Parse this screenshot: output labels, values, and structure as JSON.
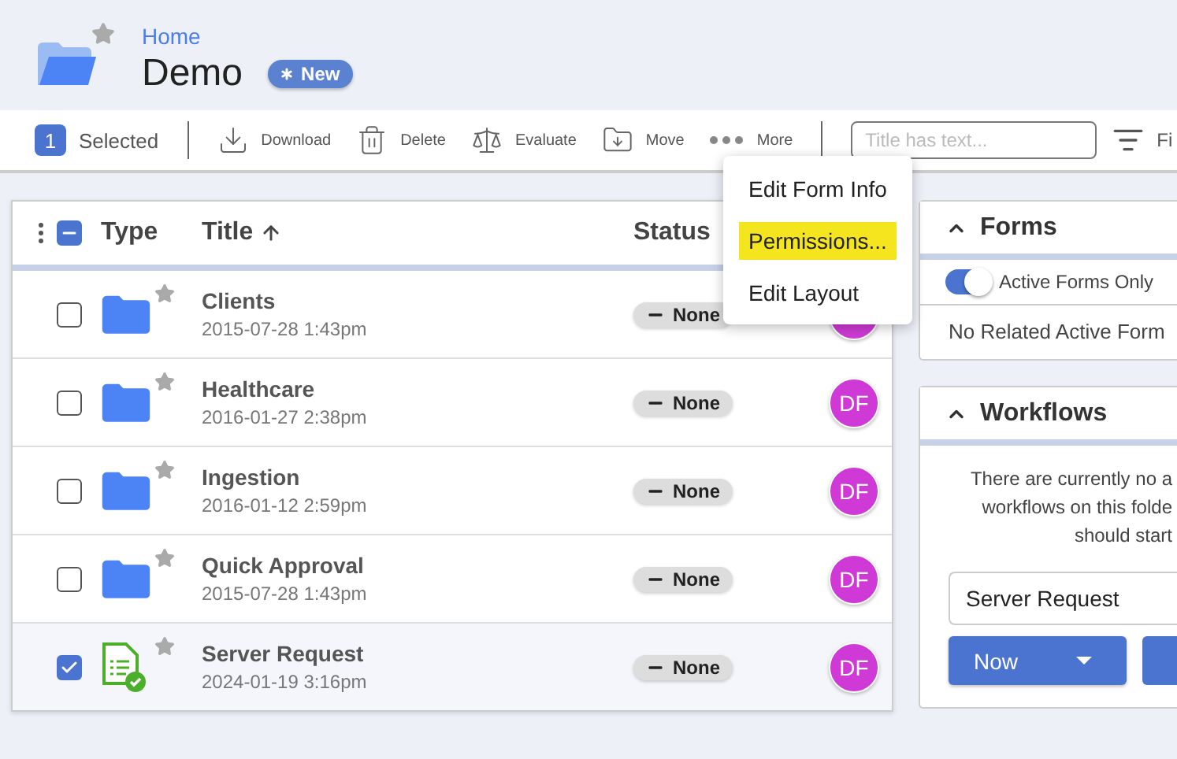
{
  "header": {
    "breadcrumb": "Home",
    "title": "Demo",
    "badge": "New",
    "starred": false
  },
  "toolbar": {
    "selected_count": "1",
    "selected_label": "Selected",
    "actions": [
      {
        "kind": "download",
        "label": "Download"
      },
      {
        "kind": "delete",
        "label": "Delete"
      },
      {
        "kind": "evaluate",
        "label": "Evaluate"
      },
      {
        "kind": "move",
        "label": "Move"
      },
      {
        "kind": "more",
        "label": "More"
      }
    ],
    "search": {
      "placeholder": "Title has text..."
    },
    "filter_label": "Fi"
  },
  "menu": {
    "items": [
      {
        "label": "Edit Form Info",
        "highlighted": false
      },
      {
        "label": "Permissions...",
        "highlighted": true
      },
      {
        "label": "Edit Layout",
        "highlighted": false
      }
    ]
  },
  "table": {
    "select_all_partial": true,
    "columns": [
      {
        "label": "Type"
      },
      {
        "label": "Title",
        "sorted": true
      },
      {
        "label": "Status"
      }
    ],
    "rows": [
      {
        "kind": "folder",
        "title": "Clients",
        "date": "2015-07-28 1:43pm",
        "status": "None",
        "checked": false,
        "starred": false
      },
      {
        "kind": "folder",
        "title": "Healthcare",
        "date": "2016-01-27 2:38pm",
        "status": "None",
        "avatar": "DF",
        "checked": false,
        "starred": false
      },
      {
        "kind": "folder",
        "title": "Ingestion",
        "date": "2016-01-12 2:59pm",
        "status": "None",
        "avatar": "DF",
        "checked": false,
        "starred": false
      },
      {
        "kind": "folder",
        "title": "Quick Approval",
        "date": "2015-07-28 1:43pm",
        "status": "None",
        "avatar": "DF",
        "checked": false,
        "starred": false
      },
      {
        "kind": "form",
        "title": "Server Request",
        "date": "2024-01-19 3:16pm",
        "status": "None",
        "avatar": "DF",
        "checked": true,
        "starred": false
      }
    ]
  },
  "forms_panel": {
    "title": "Forms",
    "expanded": true,
    "toggle": {
      "label": "Active Forms Only",
      "on": true
    },
    "message": "No Related Active Form"
  },
  "workflows_panel": {
    "title": "Workflows",
    "expanded": true,
    "message_lines": [
      "There are currently no a",
      "workflows on this folde",
      "should start"
    ],
    "select_value": "Server Request",
    "button": "Now"
  }
}
